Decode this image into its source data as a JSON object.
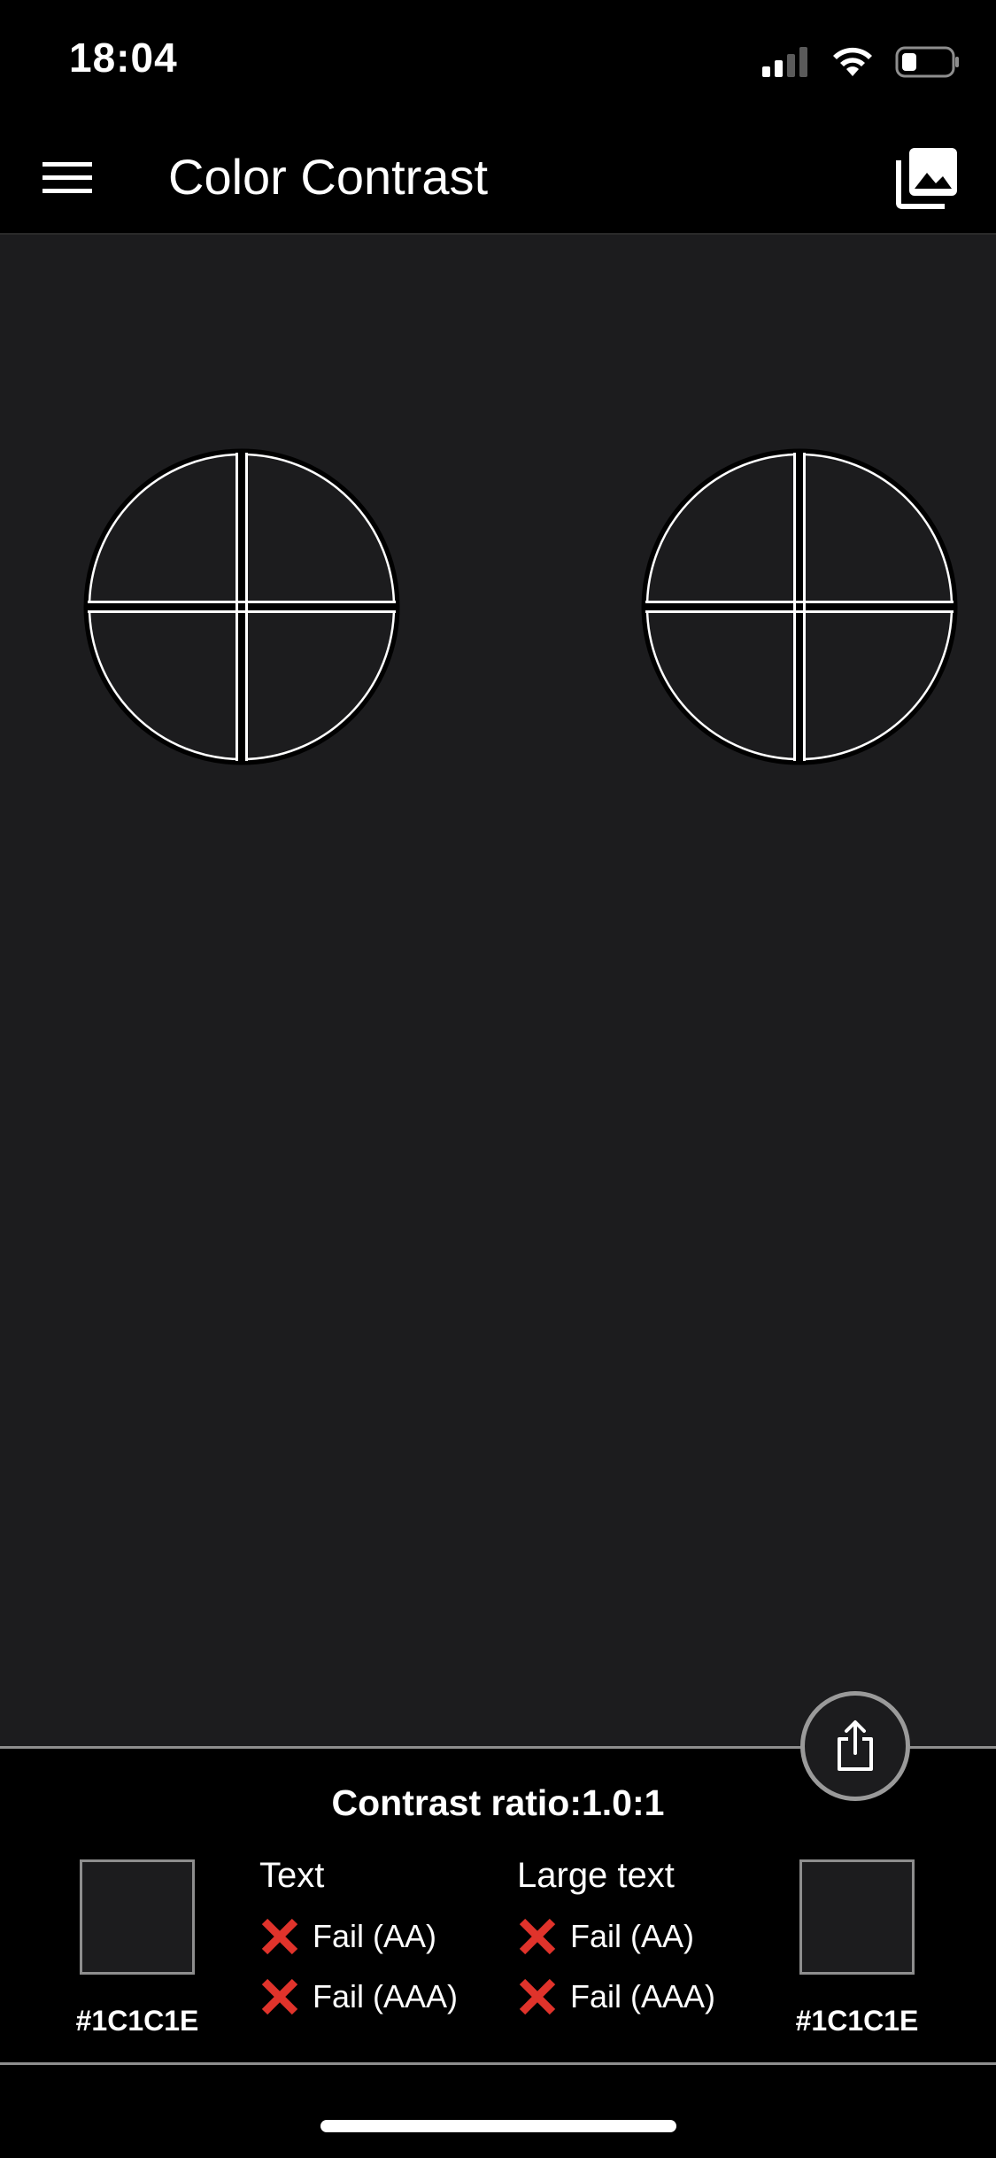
{
  "status_bar": {
    "time": "18:04",
    "icons": [
      "signal-icon",
      "wifi-icon",
      "battery-icon"
    ]
  },
  "nav": {
    "title": "Color Contrast",
    "menu_icon": "hamburger-menu-icon",
    "gallery_icon": "photo-gallery-icon"
  },
  "canvas": {
    "background_color": "#1C1C1E",
    "pickers": [
      "crosshair-picker-left",
      "crosshair-picker-right"
    ]
  },
  "panel": {
    "share_icon": "share-icon",
    "contrast_ratio": "Contrast ratio:1.0:1",
    "left_swatch": {
      "hex": "#1C1C1E",
      "color": "#1c1c1e"
    },
    "right_swatch": {
      "hex": "#1C1C1E",
      "color": "#1c1c1e"
    },
    "text_column": {
      "title": "Text",
      "results": [
        {
          "icon": "fail-x-icon",
          "label": "Fail (AA)"
        },
        {
          "icon": "fail-x-icon",
          "label": "Fail (AAA)"
        }
      ]
    },
    "large_text_column": {
      "title": "Large text",
      "results": [
        {
          "icon": "fail-x-icon",
          "label": "Fail (AA)"
        },
        {
          "icon": "fail-x-icon",
          "label": "Fail (AAA)"
        }
      ]
    }
  },
  "colors": {
    "fail": "#e0332b",
    "canvas": "#1c1c1e",
    "panel": "#000000"
  }
}
